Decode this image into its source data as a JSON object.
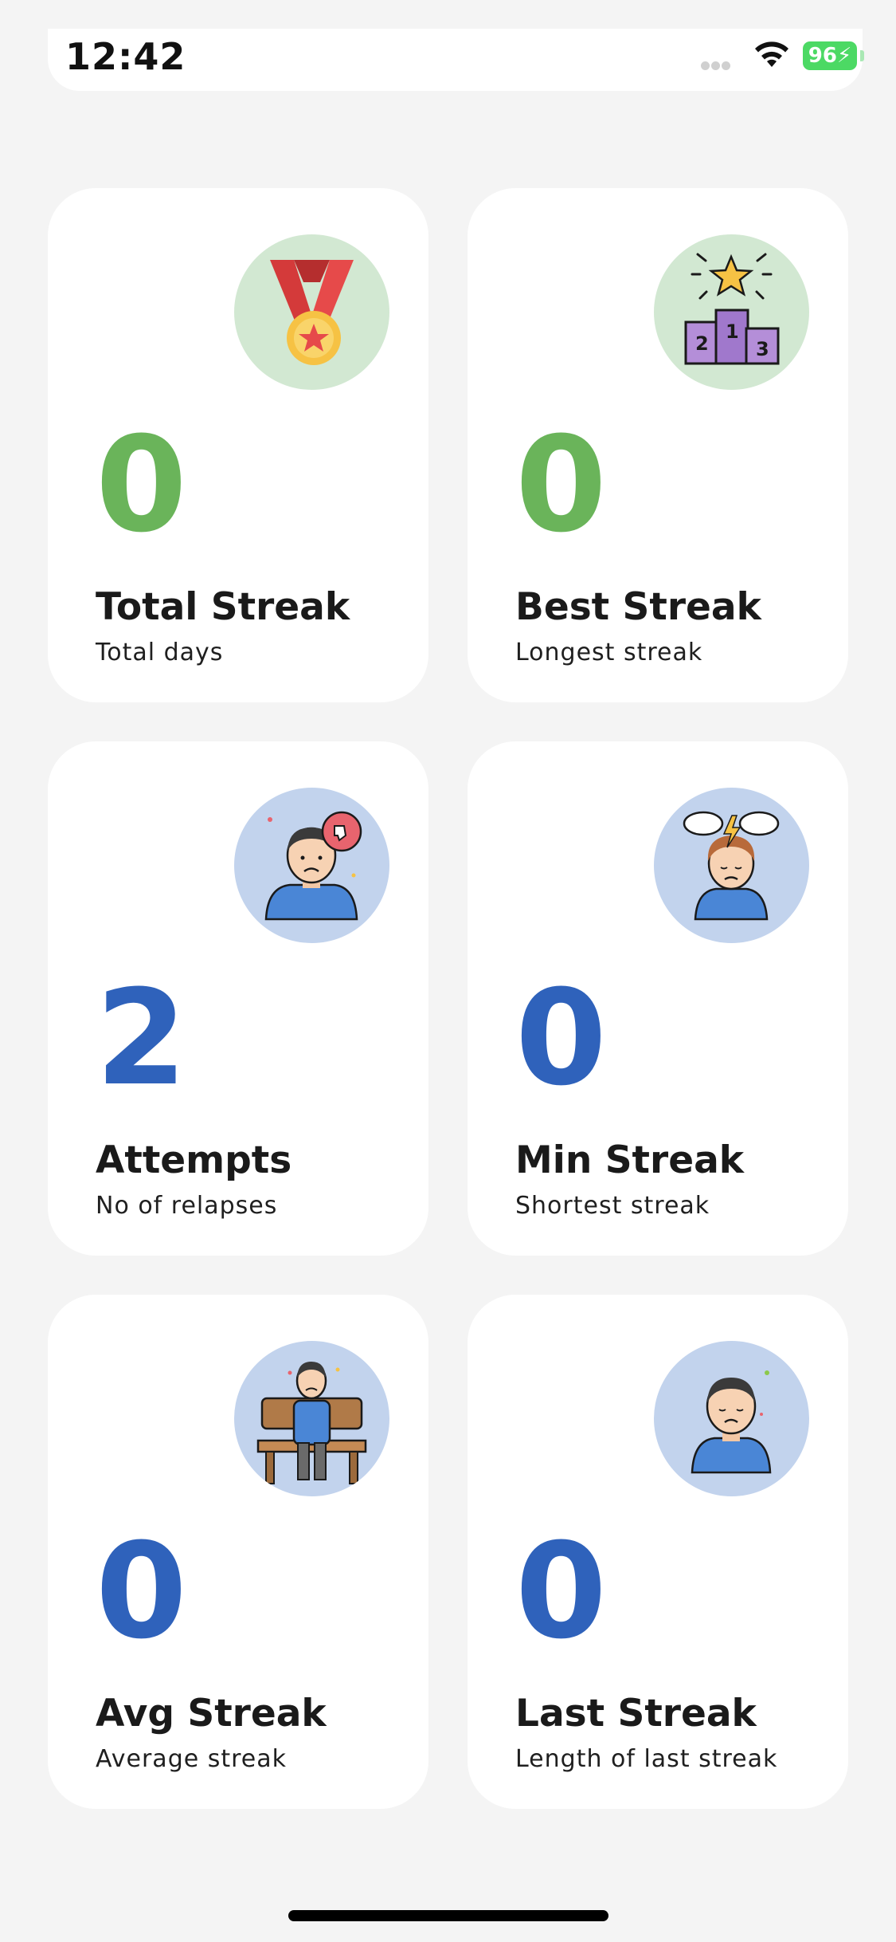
{
  "status_bar": {
    "time": "12:42",
    "battery": "96"
  },
  "cards": [
    {
      "value": "0",
      "title": "Total Streak",
      "subtitle": "Total days",
      "icon": "medal-icon",
      "accent": "#6ab45a"
    },
    {
      "value": "0",
      "title": "Best Streak",
      "subtitle": "Longest streak",
      "icon": "podium-icon",
      "accent": "#6ab45a"
    },
    {
      "value": "2",
      "title": "Attempts",
      "subtitle": "No of relapses",
      "icon": "sad-person-thumbs-down-icon",
      "accent": "#2f62bb"
    },
    {
      "value": "0",
      "title": "Min Streak",
      "subtitle": "Shortest streak",
      "icon": "stressed-person-icon",
      "accent": "#2f62bb"
    },
    {
      "value": "0",
      "title": "Avg Streak",
      "subtitle": "Average streak",
      "icon": "person-on-bench-icon",
      "accent": "#2f62bb"
    },
    {
      "value": "0",
      "title": "Last Streak",
      "subtitle": "Length of last streak",
      "icon": "sad-person-icon",
      "accent": "#2f62bb"
    }
  ]
}
